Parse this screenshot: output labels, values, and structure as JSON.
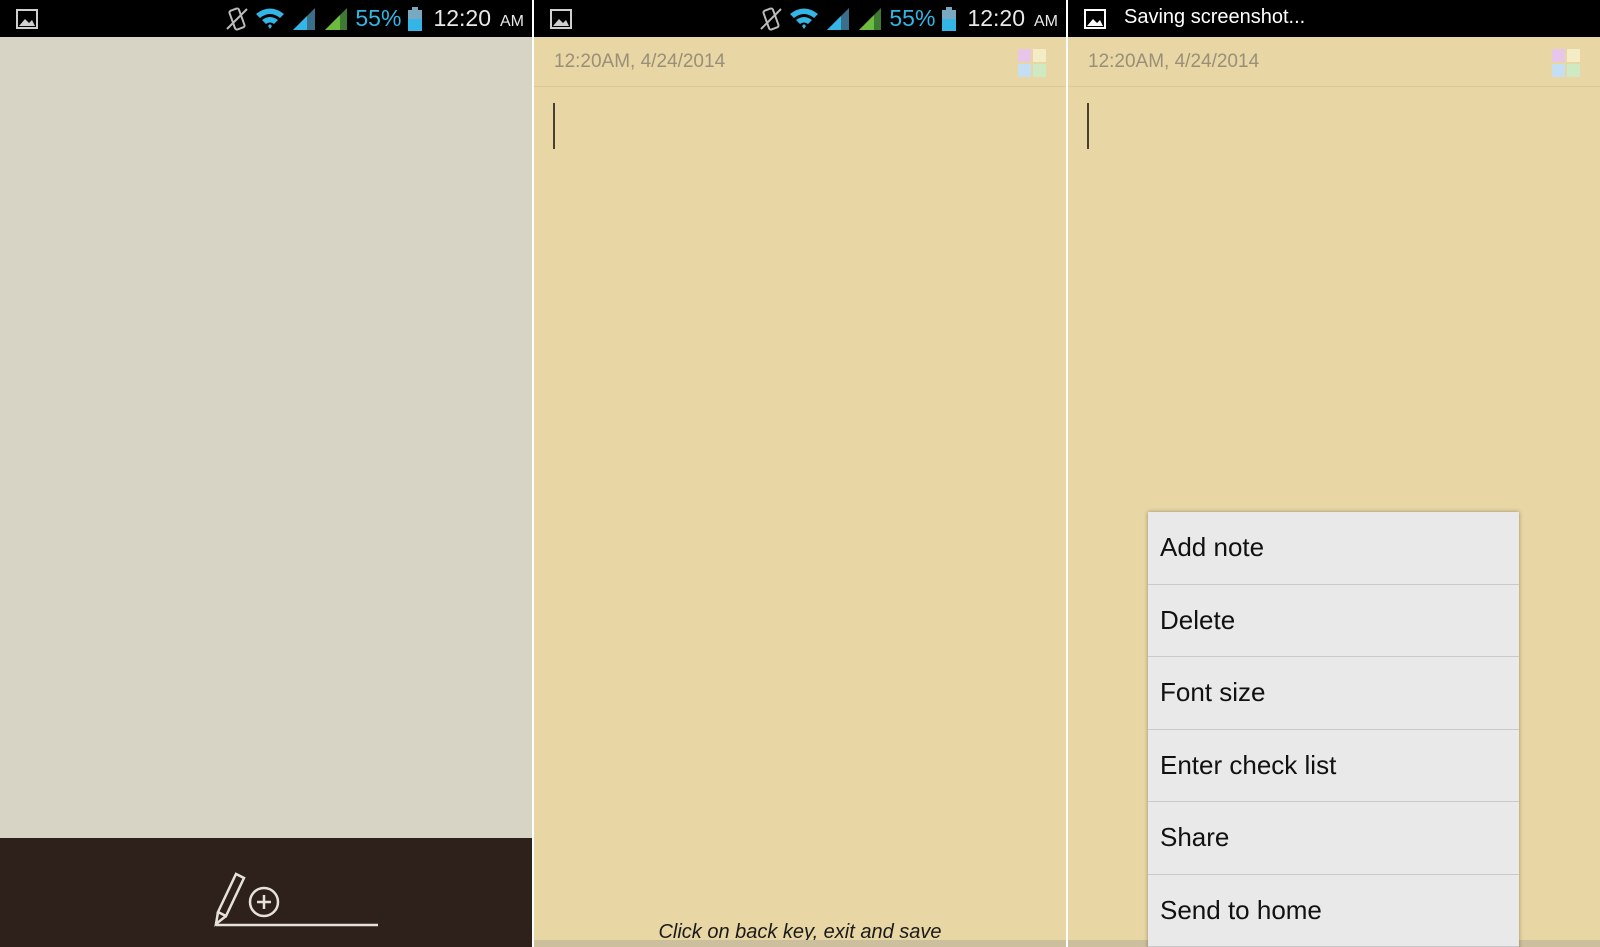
{
  "status_bar": {
    "battery_percent": "55%",
    "time": "12:20",
    "ampm": "AM",
    "notification_text": "Saving screenshot..."
  },
  "note": {
    "date": "12:20AM, 4/24/2014",
    "hint": "Click on back key, exit and save"
  },
  "menu": {
    "items": [
      {
        "label": "Add note"
      },
      {
        "label": "Delete"
      },
      {
        "label": "Font size"
      },
      {
        "label": "Enter check list"
      },
      {
        "label": "Share"
      },
      {
        "label": "Send to home"
      }
    ]
  },
  "colors": {
    "list_bg": "#d8d4c5",
    "note_bg": "#e8d6a4",
    "bottom_bar": "#2e201a",
    "battery_text": "#33b5e5"
  }
}
